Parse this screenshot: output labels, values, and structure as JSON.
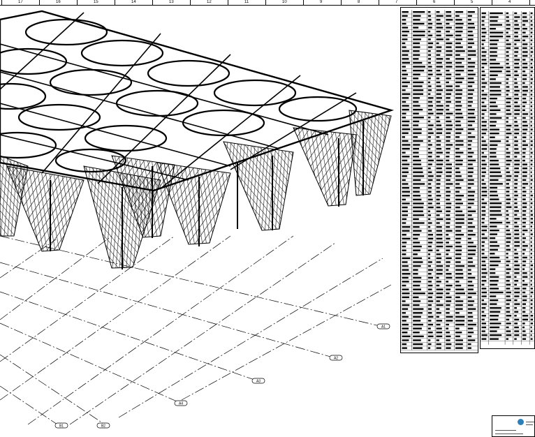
{
  "ruler": {
    "labels": [
      "17",
      "16",
      "15",
      "14",
      "13",
      "12",
      "11",
      "10",
      "9",
      "8",
      "7",
      "6",
      "5",
      "4"
    ]
  },
  "grid_tags": {
    "a1": "A1",
    "a2": "A2",
    "a3": "A3",
    "a4": "A4",
    "b1": "B1",
    "b2": "B2"
  },
  "colors": {
    "line": "#000000",
    "background": "#ffffff",
    "logo": "#2d7fb8"
  }
}
